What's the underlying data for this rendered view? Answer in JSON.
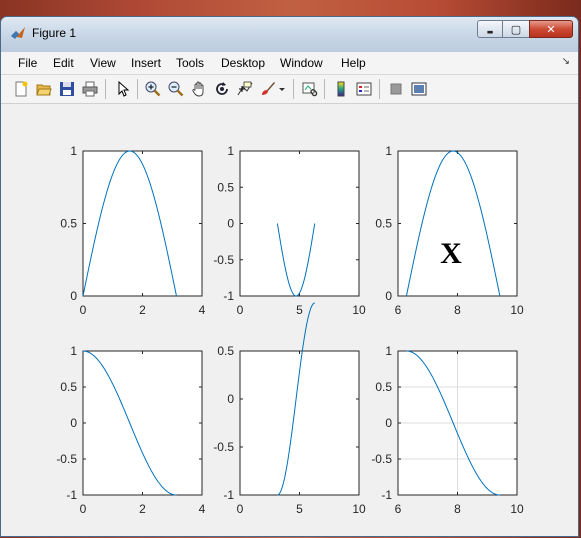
{
  "window": {
    "title": "Figure 1",
    "controls": {
      "minimize": "▬",
      "maximize": "▢",
      "close": "✕"
    }
  },
  "menubar": {
    "items": [
      "File",
      "Edit",
      "View",
      "Insert",
      "Tools",
      "Desktop",
      "Window",
      "Help"
    ],
    "dock_arrow": "↘"
  },
  "toolbar": {
    "icons": [
      "new-figure-icon",
      "open-file-icon",
      "save-icon",
      "print-icon",
      "pointer-icon",
      "zoom-in-icon",
      "zoom-out-icon",
      "pan-hand-icon",
      "rotate-3d-icon",
      "data-cursor-icon",
      "brush-icon",
      "brush-dropdown-icon",
      "link-plot-icon",
      "colorbar-icon",
      "legend-icon",
      "hide-plot-tools-icon",
      "show-plot-tools-icon"
    ]
  },
  "figure": {
    "annotation": "X",
    "line_color": "#0072BD"
  },
  "chart_data": [
    {
      "type": "line",
      "function": "sin(x)",
      "x_range": [
        0,
        3.1416
      ],
      "xlim": [
        0,
        4
      ],
      "ylim": [
        0,
        1
      ],
      "xticks": [
        "0",
        "2",
        "4"
      ],
      "yticks": [
        "0",
        "0.5",
        "1"
      ],
      "grid": false
    },
    {
      "type": "line",
      "function": "sin(x)",
      "x_range": [
        3.1416,
        6.2832
      ],
      "xlim": [
        0,
        10
      ],
      "ylim": [
        -1,
        1
      ],
      "xticks": [
        "0",
        "5",
        "10"
      ],
      "yticks": [
        "-1",
        "-0.5",
        "0",
        "0.5",
        "1"
      ],
      "grid": false
    },
    {
      "type": "line",
      "function": "sin(x)",
      "x_range": [
        6.2832,
        9.4248
      ],
      "xlim": [
        6,
        10
      ],
      "ylim": [
        0,
        1
      ],
      "xticks": [
        "6",
        "8",
        "10"
      ],
      "yticks": [
        "0",
        "0.5",
        "1"
      ],
      "grid": false,
      "annotation": "X"
    },
    {
      "type": "line",
      "function": "cos(x)",
      "x_range": [
        0,
        3.1416
      ],
      "xlim": [
        0,
        4
      ],
      "ylim": [
        -1,
        1
      ],
      "xticks": [
        "0",
        "2",
        "4"
      ],
      "yticks": [
        "-1",
        "-0.5",
        "0",
        "0.5",
        "1"
      ],
      "grid": false
    },
    {
      "type": "line",
      "function": "cos(x)",
      "x_range": [
        3.1416,
        6.2832
      ],
      "xlim": [
        0,
        10
      ],
      "ylim": [
        -1,
        0.5
      ],
      "xticks": [
        "0",
        "5",
        "10"
      ],
      "yticks": [
        "-1",
        "-0.5",
        "0",
        "0.5"
      ],
      "grid": false
    },
    {
      "type": "line",
      "function": "cos(x)",
      "x_range": [
        6.2832,
        9.4248
      ],
      "xlim": [
        6,
        10
      ],
      "ylim": [
        -1,
        1
      ],
      "xticks": [
        "6",
        "8",
        "10"
      ],
      "yticks": [
        "-1",
        "-0.5",
        "0",
        "0.5",
        "1"
      ],
      "grid": true
    }
  ]
}
